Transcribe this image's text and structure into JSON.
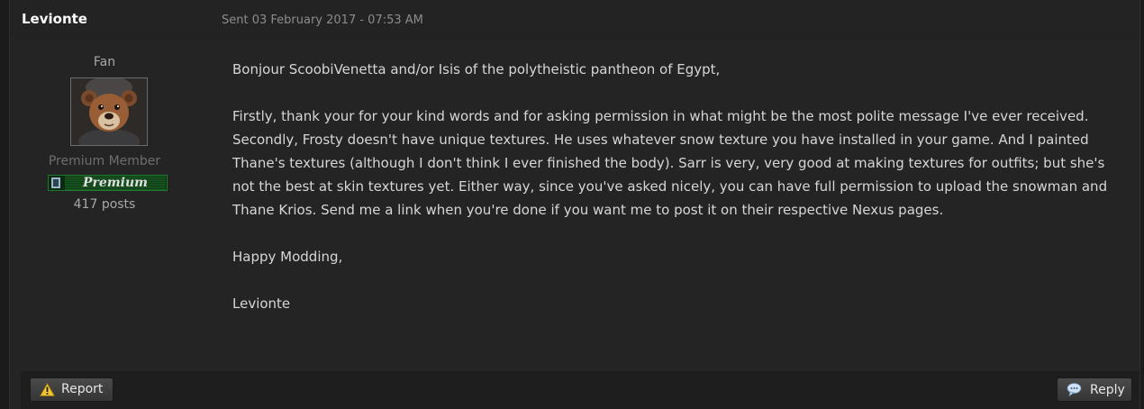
{
  "message": {
    "author": "Levionte",
    "sent": "Sent 03 February 2017 - 07:53 AM"
  },
  "profile": {
    "rank_title": "Fan",
    "avatar_icon": "teddy-bear-avatar",
    "member_group": "Premium Member",
    "badge_label": "Premium",
    "post_count": "417 posts"
  },
  "body": {
    "greeting": "Bonjour ScoobiVenetta and/or Isis of the polytheistic pantheon of Egypt,",
    "line1": "Firstly, thank your for your kind words and for asking permission in what might be the most polite message I've ever received.",
    "line2": "Secondly, Frosty doesn't have unique textures. He uses whatever snow texture you have installed in your game. And I painted Thane's textures (although I don't think I ever finished the body). Sarr is very, very good at making textures for outfits; but she's not the best at skin textures yet. Either way, since you've asked nicely, you can have full permission to upload the snowman and Thane Krios. Send me a link when you're done if you want me to post it on their respective Nexus pages.",
    "signoff": "Happy Modding,",
    "signature": "Levionte"
  },
  "actions": {
    "report_label": "Report",
    "report_icon": "warning-icon",
    "reply_label": "Reply",
    "reply_icon": "speech-bubble-icon"
  },
  "colors": {
    "background": "#242424",
    "text": "#d6d6d6",
    "muted": "#8c8c8c",
    "badge_green": "#1e7a32",
    "warning_yellow": "#f2c530"
  }
}
